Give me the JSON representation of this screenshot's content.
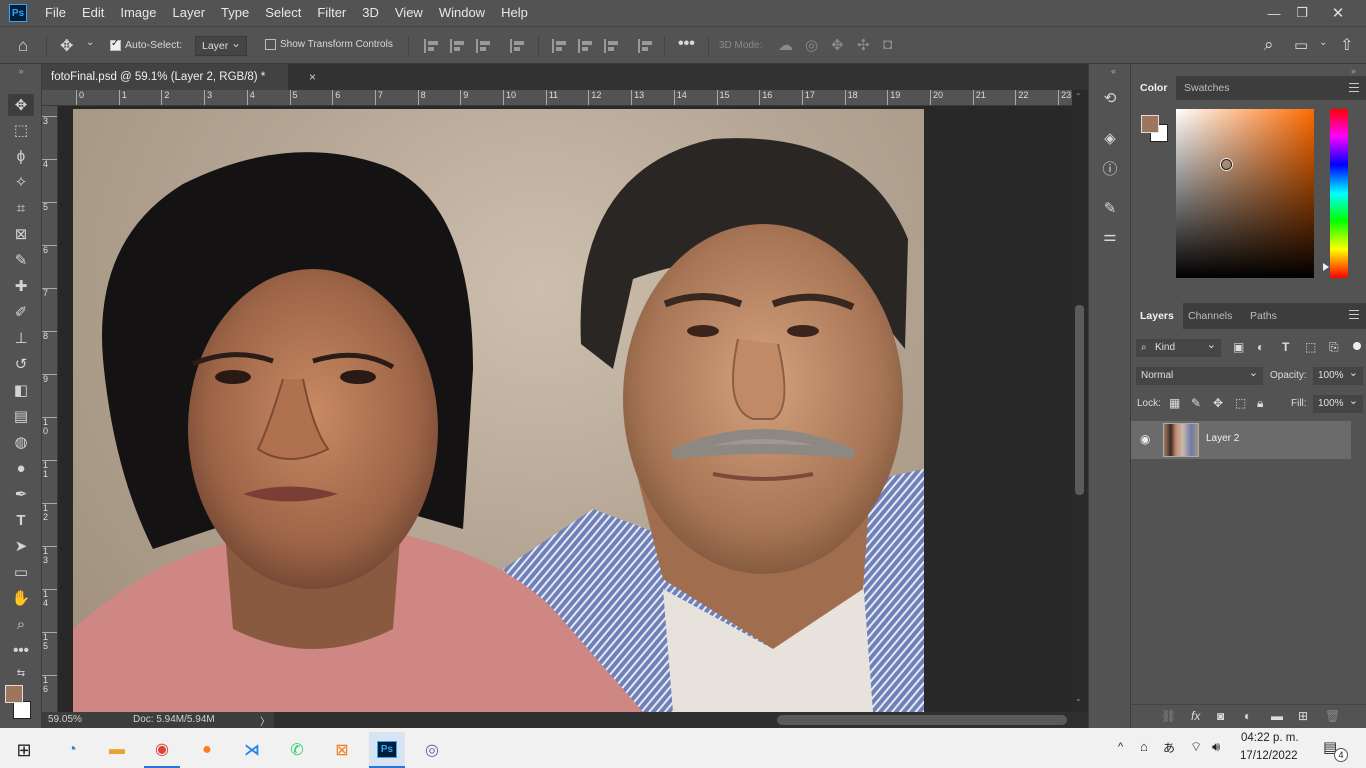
{
  "menubar": {
    "logo": "Ps",
    "items": [
      "File",
      "Edit",
      "Image",
      "Layer",
      "Type",
      "Select",
      "Filter",
      "3D",
      "View",
      "Window",
      "Help"
    ]
  },
  "options": {
    "auto_select_label": "Auto-Select:",
    "auto_select_target": "Layer",
    "show_transform_label": "Show Transform Controls",
    "mode_3d_label": "3D Mode:"
  },
  "document": {
    "tab_title": "fotoFinal.psd @ 59.1% (Layer 2, RGB/8) *",
    "close_glyph": "×"
  },
  "rulers": {
    "top_ticks": [
      "0",
      "1",
      "2",
      "3",
      "4",
      "5",
      "6",
      "7",
      "8",
      "9",
      "10",
      "11",
      "12",
      "13",
      "14",
      "15",
      "16",
      "17",
      "18",
      "19",
      "20",
      "21",
      "22",
      "23"
    ],
    "left_ticks": [
      "3",
      "4",
      "5",
      "6",
      "7",
      "8",
      "9",
      "1\n0",
      "1\n1",
      "1\n2",
      "1\n3",
      "1\n4",
      "1\n5",
      "1\n6"
    ]
  },
  "status": {
    "zoom": "59.05%",
    "doc_size": "Doc: 5.94M/5.94M",
    "arrow": "〉"
  },
  "color_panel": {
    "tabs": [
      "Color",
      "Swatches"
    ],
    "foreground": "#a07560",
    "background": "#ffffff"
  },
  "layers_panel": {
    "tabs": [
      "Layers",
      "Channels",
      "Paths"
    ],
    "filter_kind": "Kind",
    "blend_mode": "Normal",
    "opacity_label": "Opacity:",
    "opacity_value": "100%",
    "lock_label": "Lock:",
    "fill_label": "Fill:",
    "fill_value": "100%",
    "layers": [
      {
        "name": "Layer 2",
        "visible": true
      }
    ]
  },
  "taskbar": {
    "time": "04:22 p. m.",
    "date": "17/12/2022",
    "notification_count": "4"
  },
  "colors": {
    "ui_dark": "#535353",
    "canvas_bg": "#282828",
    "ps_blue": "#31a8ff"
  }
}
